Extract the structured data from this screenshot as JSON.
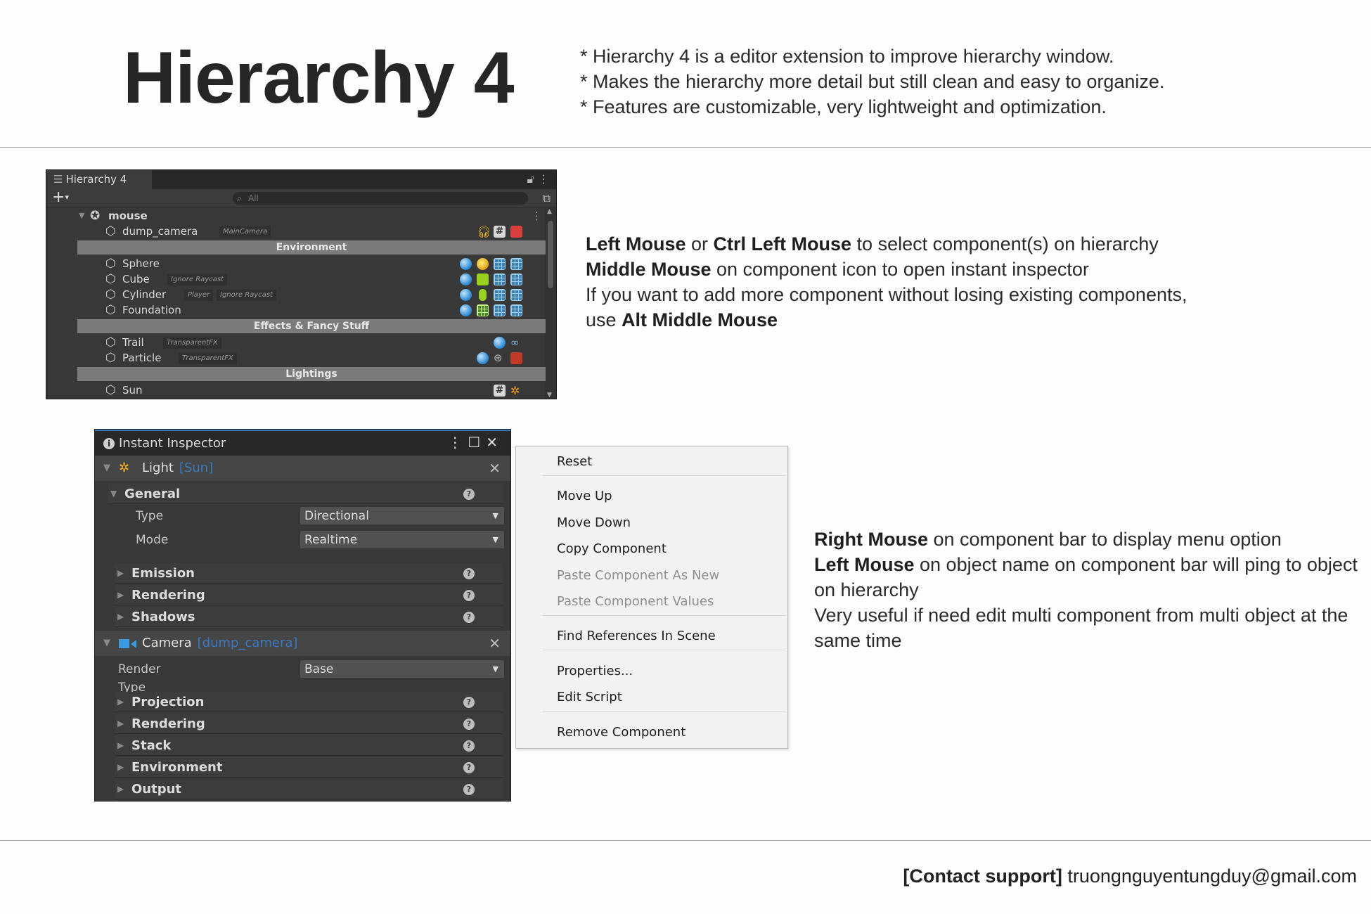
{
  "header": {
    "title": "Hierarchy 4",
    "intro": [
      "* Hierarchy 4 is a editor extension to improve hierarchy window.",
      "* Makes the hierarchy more detail but still clean and easy to organize.",
      "* Features are customizable, very lightweight and optimization."
    ]
  },
  "hierarchy_window": {
    "tab_label": "Hierarchy 4",
    "search_placeholder": "All",
    "root": "mouse",
    "rows": [
      {
        "name": "dump_camera",
        "tag": "MainCamera"
      },
      {
        "name": "Environment",
        "separator": true
      },
      {
        "name": "Sphere",
        "tag": ""
      },
      {
        "name": "Cube",
        "tag": "Ignore Raycast"
      },
      {
        "name": "Cylinder",
        "tag": "Player",
        "tag2": "Ignore Raycast"
      },
      {
        "name": "Foundation",
        "tag": ""
      },
      {
        "name": "Effects & Fancy Stuff",
        "separator": true
      },
      {
        "name": "Trail",
        "tag": "TransparentFX"
      },
      {
        "name": "Particle",
        "tag": "TransparentFX"
      },
      {
        "name": "Lightings",
        "separator": true
      },
      {
        "name": "Sun",
        "tag": ""
      }
    ]
  },
  "desc1": {
    "l1_b1": "Left Mouse",
    "l1_t1": " or ",
    "l1_b2": "Ctrl Left Mouse",
    "l1_t2": " to select component(s) on hierarchy",
    "l2_b": "Middle Mouse",
    "l2_t": " on component icon to open instant inspector",
    "l3": "If you want to add more component without losing existing components,",
    "l4_t": "use ",
    "l4_b": "Alt Middle Mouse"
  },
  "inspector": {
    "title": "Instant Inspector",
    "light": {
      "name": "Light",
      "object": "[Sun]"
    },
    "general": "General",
    "type_label": "Type",
    "type_value": "Directional",
    "mode_label": "Mode",
    "mode_value": "Realtime",
    "light_sections": [
      "Emission",
      "Rendering",
      "Shadows"
    ],
    "camera": {
      "name": "Camera",
      "object": "[dump_camera]"
    },
    "render_type_label": "Render Type",
    "render_type_value": "Base",
    "camera_sections": [
      "Projection",
      "Rendering",
      "Stack",
      "Environment",
      "Output"
    ]
  },
  "context_menu": {
    "items": [
      {
        "label": "Reset",
        "disabled": false
      },
      {
        "label": "Move Up",
        "disabled": false
      },
      {
        "label": "Move Down",
        "disabled": false
      },
      {
        "label": "Copy Component",
        "disabled": false
      },
      {
        "label": "Paste Component As New",
        "disabled": true
      },
      {
        "label": "Paste Component Values",
        "disabled": true
      },
      {
        "label": "Find References In Scene",
        "disabled": false
      },
      {
        "label": "Properties...",
        "disabled": false
      },
      {
        "label": "Edit Script",
        "disabled": false
      },
      {
        "label": "Remove Component",
        "disabled": false
      }
    ]
  },
  "desc2": {
    "l1_b": "Right Mouse",
    "l1_t": " on component bar to display menu option",
    "l2_b": "Left Mouse",
    "l2_t": " on object name on component bar will ping to object",
    "l3": "on hierarchy",
    "l4": "Very useful if need edit multi component from multi object at the",
    "l5": "same time"
  },
  "contact": {
    "label": "[Contact support]",
    "email": "truongnguyentungduy@gmail.com"
  }
}
